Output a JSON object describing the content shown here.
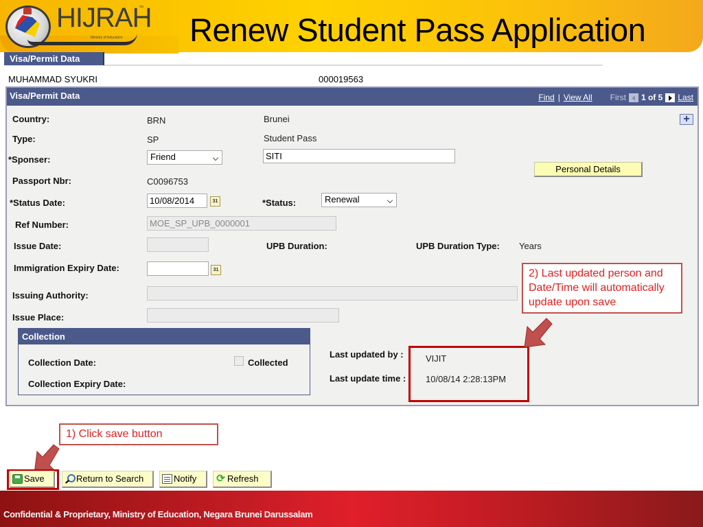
{
  "header": {
    "logo_text": "HIJRAH",
    "logo_tm": "™",
    "logo_subtitle": "Ministry of Education",
    "page_title": "Renew Student Pass Application"
  },
  "tab": {
    "label": "Visa/Permit Data"
  },
  "employee": {
    "name": "MUHAMMAD SYUKRI",
    "id": "000019563"
  },
  "panel": {
    "title": "Visa/Permit Data",
    "nav": {
      "find": "Find",
      "separator": "|",
      "view_all": "View All",
      "first": "First",
      "count": "1 of 5",
      "last": "Last"
    },
    "add_icon": "+"
  },
  "form": {
    "country": {
      "label": "Country:",
      "code": "BRN",
      "name": "Brunei"
    },
    "type": {
      "label": "Type:",
      "code": "SP",
      "name": "Student Pass"
    },
    "sponser": {
      "label": "*Sponser:",
      "selected": "Friend",
      "name_value": "SITI"
    },
    "passport": {
      "label": "Passport Nbr:",
      "value": "C0096753"
    },
    "status_date": {
      "label": "*Status Date:",
      "value": "10/08/2014"
    },
    "status": {
      "label": "*Status:",
      "selected": "Renewal"
    },
    "ref_number": {
      "label": "Ref Number:",
      "value": "MOE_SP_UPB_0000001"
    },
    "issue_date": {
      "label": "Issue Date:",
      "value": ""
    },
    "upb_duration": {
      "label": "UPB Duration:",
      "value": ""
    },
    "upb_duration_type": {
      "label": "UPB Duration Type:",
      "value": "Years"
    },
    "immigration_expiry": {
      "label": "Immigration Expiry Date:",
      "value": ""
    },
    "issuing_authority": {
      "label": "Issuing Authority:",
      "value": ""
    },
    "issue_place": {
      "label": "Issue Place:",
      "value": ""
    },
    "personal_details_button": "Personal Details",
    "calendar_icon_text": "31"
  },
  "collection": {
    "title": "Collection",
    "collection_date_label": "Collection Date:",
    "collected_label": "Collected",
    "collected_checked": false,
    "collection_expiry_label": "Collection Expiry Date:"
  },
  "audit": {
    "updated_by_label": "Last updated by :",
    "updated_by_value": "VIJIT",
    "update_time_label": "Last update time :",
    "update_time_value": "10/08/14  2:28:13PM"
  },
  "annotations": {
    "note1": "1) Click save button",
    "note2": "2) Last updated person and Date/Time will automatically update upon save",
    "color": "#c00000"
  },
  "toolbar": {
    "save": "Save",
    "return_to_search": "Return to Search",
    "notify": "Notify",
    "refresh": "Refresh"
  },
  "footer": {
    "text": "Confidential & Proprietary, Ministry of Education, Negara Brunei Darussalam"
  },
  "colors": {
    "banner_yellow": "#ffd200",
    "panel_header": "#4b5a8b",
    "button_yellow": "#fcfcb4",
    "footer_red": "#c41c24"
  }
}
